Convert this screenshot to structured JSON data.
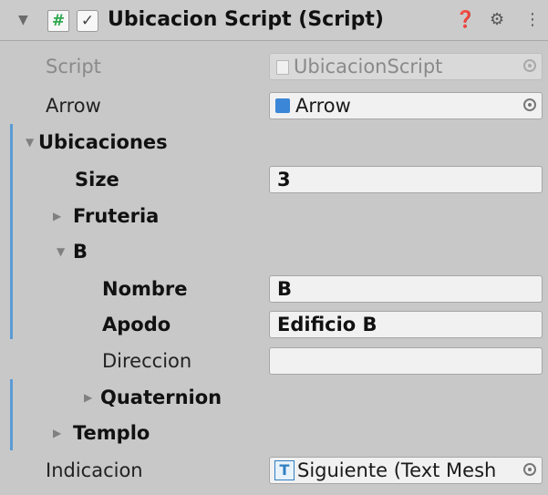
{
  "header": {
    "title": "Ubicacion Script (Script)",
    "enabled": true
  },
  "rows": {
    "script": {
      "label": "Script",
      "value": "UbicacionScript"
    },
    "arrow": {
      "label": "Arrow",
      "value": "Arrow"
    },
    "ubicaciones": {
      "label": "Ubicaciones"
    },
    "size": {
      "label": "Size",
      "value": "3"
    },
    "fruteria": {
      "label": "Fruteria"
    },
    "b": {
      "label": "B"
    },
    "nombre": {
      "label": "Nombre",
      "value": "B"
    },
    "apodo": {
      "label": "Apodo",
      "value": "Edificio B"
    },
    "direccion": {
      "label": "Direccion",
      "value": ""
    },
    "quaternion": {
      "label": "Quaternion"
    },
    "templo": {
      "label": "Templo"
    },
    "indicacion": {
      "label": "Indicacion",
      "value": "Siguiente (Text Mesh"
    }
  },
  "icons": {
    "script_component": "hash-icon",
    "help": "help-icon",
    "presets": "presets-icon",
    "menu": "kebab-menu-icon",
    "object_picker": "object-picker-icon",
    "prefab": "prefab-cube-icon",
    "text_mesh": "text-mesh-icon"
  },
  "colors": {
    "modified_bar": "#5a9bd5",
    "script_icon": "#2fa84f",
    "prefab_icon": "#3b86d6",
    "text_mesh_icon": "#2f7fc3"
  }
}
